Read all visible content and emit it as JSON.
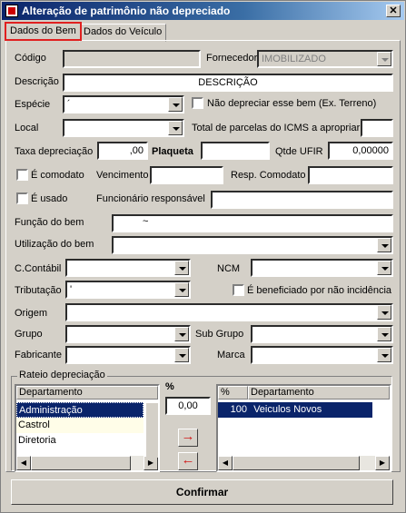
{
  "window": {
    "title": "Alteração de patrimônio não depreciado",
    "close_glyph": "✕"
  },
  "tabs": [
    {
      "label": "Dados do Bem",
      "active": true
    },
    {
      "label": "Dados do Veículo",
      "active": false
    }
  ],
  "form": {
    "codigo": {
      "label": "Código",
      "value": ""
    },
    "fornecedor": {
      "label": "Fornecedor",
      "value": "IMOBILIZADO"
    },
    "descricao": {
      "label": "Descrição",
      "value": "DESCRIÇÃO"
    },
    "especie": {
      "label": "Espécie",
      "value": "´"
    },
    "nao_depreciar": {
      "label": "Não depreciar esse bem (Ex. Terreno)",
      "checked": false
    },
    "local": {
      "label": "Local",
      "value": ""
    },
    "total_parcelas": {
      "label": "Total de parcelas do ICMS a apropriar",
      "value": ""
    },
    "taxa_depreciacao": {
      "label": "Taxa depreciação",
      "value": ",00"
    },
    "plaqueta": {
      "label": "Plaqueta",
      "value": ""
    },
    "qtde_ufir": {
      "label": "Qtde UFIR",
      "value": "0,00000"
    },
    "comodato": {
      "label": "É comodato",
      "checked": false
    },
    "vencimento": {
      "label": "Vencimento",
      "value": ""
    },
    "resp_comodato": {
      "label": "Resp. Comodato",
      "value": ""
    },
    "usado": {
      "label": "É usado",
      "checked": false
    },
    "funcionario": {
      "label": "Funcionário responsável",
      "value": ""
    },
    "funcao": {
      "label": "Função do bem",
      "value": "~"
    },
    "utilizacao": {
      "label": "Utilização do bem",
      "value": ""
    },
    "c_contabil": {
      "label": "C.Contábil",
      "value": ""
    },
    "ncm": {
      "label": "NCM",
      "value": ""
    },
    "tributacao": {
      "label": "Tributação",
      "value": "'"
    },
    "beneficiado": {
      "label": "É beneficiado por não incidência",
      "checked": false
    },
    "origem": {
      "label": "Origem",
      "value": ""
    },
    "grupo": {
      "label": "Grupo",
      "value": ""
    },
    "sub_grupo": {
      "label": "Sub Grupo",
      "value": ""
    },
    "fabricante": {
      "label": "Fabricante",
      "value": ""
    },
    "marca": {
      "label": "Marca",
      "value": ""
    }
  },
  "rateio": {
    "title": "Rateio depreciação",
    "left_list": {
      "header": "Departamento",
      "rows": [
        "Administração",
        "Castrol",
        "Diretoria"
      ],
      "selected_index": 0
    },
    "percent_label": "%",
    "percent_value": "0,00",
    "add_arrow": "→",
    "remove_arrow": "←",
    "right_list": {
      "headers": [
        "%",
        "Departamento"
      ],
      "rows": [
        {
          "pct": "100",
          "dept": "Veiculos Novos"
        }
      ],
      "selected_index": 0
    }
  },
  "confirm_button": "Confirmar",
  "colors": {
    "selection": "#0a246a",
    "tab_highlight": "#e02020",
    "arrow_red": "#d01818",
    "row_alt": "#fffde8"
  }
}
